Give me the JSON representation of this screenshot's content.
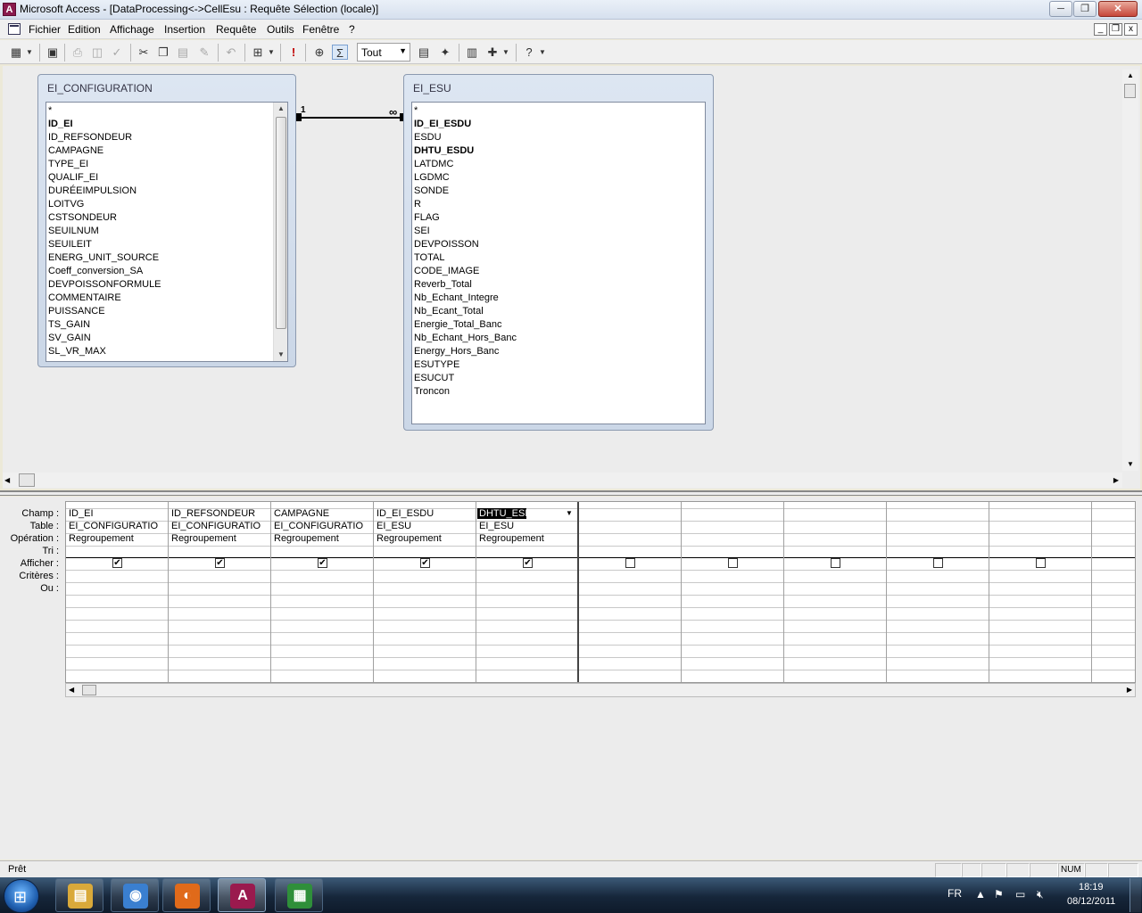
{
  "window": {
    "title": "Microsoft Access - [DataProcessing<->CellEsu : Requête Sélection (locale)]",
    "min_label": "─",
    "max_label": "❐",
    "close_label": "✕"
  },
  "menu": {
    "items": [
      "Fichier",
      "Edition",
      "Affichage",
      "Insertion",
      "Requête",
      "Outils",
      "Fenêtre",
      "?"
    ],
    "mdi_buttons": [
      "_",
      "❐",
      "x"
    ]
  },
  "toolbar": {
    "top_values_value": "Tout",
    "dropdown_arrow": "▼",
    "icons": [
      "view-icon",
      "save-icon",
      "print-icon",
      "print-preview-icon",
      "spelling-icon",
      "cut-icon",
      "copy-icon",
      "paste-icon",
      "format-painter-icon",
      "undo-icon",
      "query-type-icon",
      "run-icon",
      "show-table-icon",
      "totals-icon",
      "properties-icon",
      "build-icon",
      "database-window-icon",
      "new-object-icon",
      "help-icon"
    ]
  },
  "tables": [
    {
      "name": "EI_CONFIGURATION",
      "fields": [
        "*",
        "ID_EI",
        "ID_REFSONDEUR",
        "CAMPAGNE",
        "TYPE_EI",
        "QUALIF_EI",
        "DURÉEIMPULSION",
        "LOITVG",
        "CSTSONDEUR",
        "SEUILNUM",
        "SEUILEIT",
        "ENERG_UNIT_SOURCE",
        "Coeff_conversion_SA",
        "DEVPOISSONFORMULE",
        "COMMENTAIRE",
        "PUISSANCE",
        "TS_GAIN",
        "SV_GAIN",
        "SL_VR_MAX"
      ],
      "key_fields": [
        "ID_EI"
      ]
    },
    {
      "name": "EI_ESU",
      "fields": [
        "*",
        "ID_EI_ESDU",
        "ESDU",
        "DHTU_ESDU",
        "LATDMC",
        "LGDMC",
        "SONDE",
        "R",
        "FLAG",
        "SEI",
        "DEVPOISSON",
        "TOTAL",
        "CODE_IMAGE",
        "Reverb_Total",
        "Nb_Echant_Integre",
        "Nb_Ecant_Total",
        "Energie_Total_Banc",
        "Nb_Echant_Hors_Banc",
        "Energy_Hors_Banc",
        "ESUTYPE",
        "ESUCUT",
        "Troncon"
      ],
      "key_fields": [
        "ID_EI_ESDU",
        "DHTU_ESDU"
      ]
    }
  ],
  "relationship": {
    "one_label": "1",
    "many_label": "∞"
  },
  "grid": {
    "row_labels": [
      "Champ :",
      "Table :",
      "Opération :",
      "Tri :",
      "Afficher :",
      "Critères :",
      "Ou :"
    ],
    "columns": [
      {
        "champ": "ID_EI",
        "table": "EI_CONFIGURATIO",
        "operation": "Regroupement",
        "tri": "",
        "afficher": true
      },
      {
        "champ": "ID_REFSONDEUR",
        "table": "EI_CONFIGURATIO",
        "operation": "Regroupement",
        "tri": "",
        "afficher": true
      },
      {
        "champ": "CAMPAGNE",
        "table": "EI_CONFIGURATIO",
        "operation": "Regroupement",
        "tri": "",
        "afficher": true
      },
      {
        "champ": "ID_EI_ESDU",
        "table": "EI_ESU",
        "operation": "Regroupement",
        "tri": "",
        "afficher": true
      },
      {
        "champ": "DHTU_ESDU",
        "table": "EI_ESU",
        "operation": "Regroupement",
        "tri": "",
        "afficher": true,
        "selected": true
      },
      {
        "champ": "",
        "table": "",
        "operation": "",
        "tri": "",
        "afficher": false
      },
      {
        "champ": "",
        "table": "",
        "operation": "",
        "tri": "",
        "afficher": false
      },
      {
        "champ": "",
        "table": "",
        "operation": "",
        "tri": "",
        "afficher": false
      },
      {
        "champ": "",
        "table": "",
        "operation": "",
        "tri": "",
        "afficher": false
      },
      {
        "champ": "",
        "table": "",
        "operation": "",
        "tri": "",
        "afficher": false
      },
      {
        "champ": "",
        "table": "",
        "operation": "",
        "tri": "",
        "afficher": false
      }
    ],
    "check_mark": "✔"
  },
  "status": {
    "text": "Prêt",
    "panels": [
      "",
      "",
      "",
      "",
      "",
      "NUM",
      "",
      ""
    ]
  },
  "taskbar": {
    "apps": [
      {
        "name": "explorer",
        "glyph": "▤",
        "color": "#d9a93a"
      },
      {
        "name": "messenger",
        "glyph": "◉",
        "color": "#3a7fd0"
      },
      {
        "name": "firefox",
        "glyph": "◐",
        "color": "#e06a1a"
      },
      {
        "name": "access",
        "glyph": "A",
        "color": "#9a1a4e",
        "active": true
      },
      {
        "name": "calc",
        "glyph": "▦",
        "color": "#2f8f3a"
      }
    ],
    "language": "FR",
    "time": "18:19",
    "date": "08/12/2011"
  }
}
